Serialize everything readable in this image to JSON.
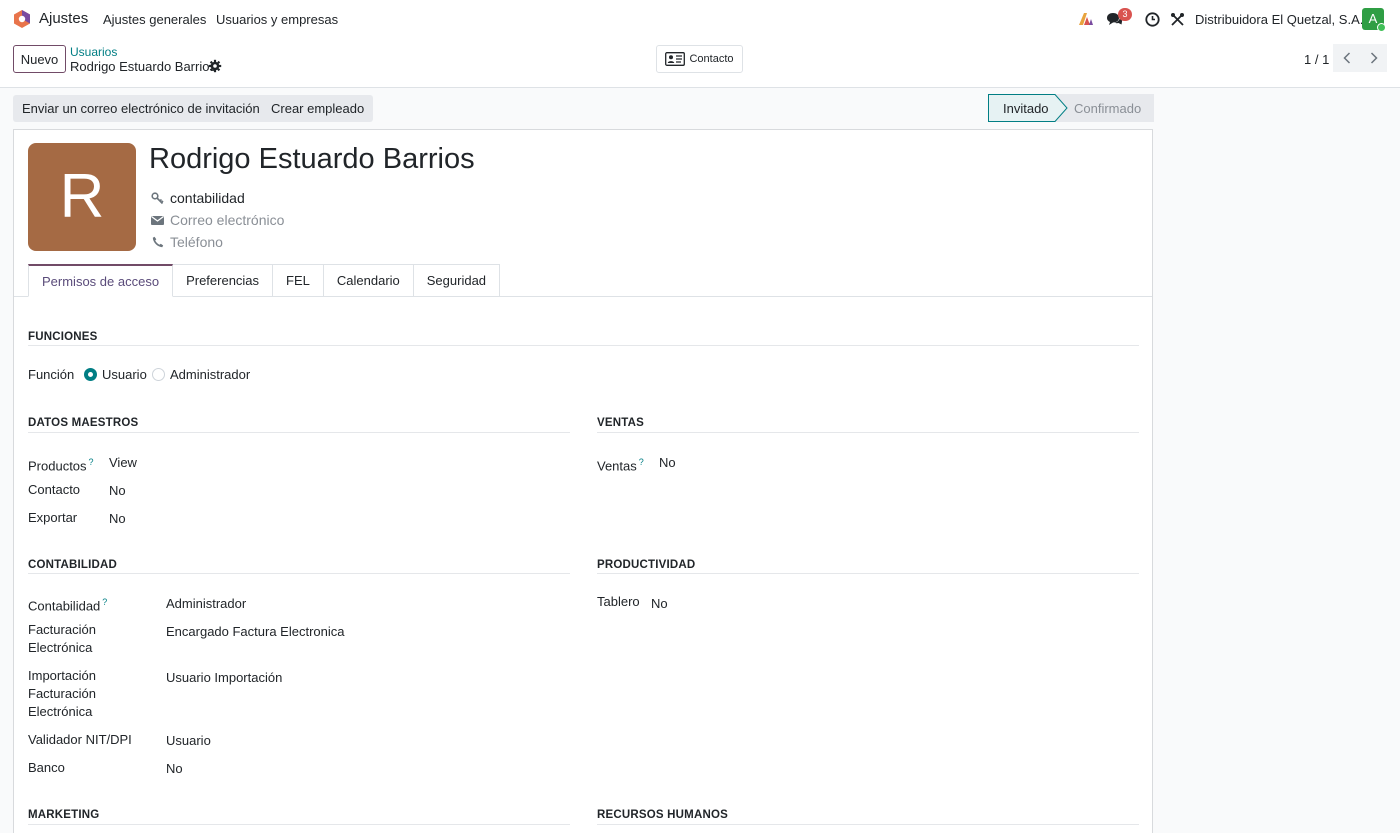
{
  "nav": {
    "app_name": "Ajustes",
    "menu": [
      "Ajustes generales",
      "Usuarios y empresas"
    ],
    "badge_count": "3",
    "company": "Distribuidora El Quetzal, S.A.",
    "user_initial": "A"
  },
  "control": {
    "new_label": "Nuevo",
    "breadcrumb_parent": "Usuarios",
    "breadcrumb_current": "Rodrigo Estuardo Barrios",
    "contact_label": "Contacto",
    "pager": "1 / 1"
  },
  "statusbar": {
    "invite_label": "Enviar un correo electrónico de invitación",
    "create_employee_label": "Crear empleado",
    "stages": [
      "Invitado",
      "Confirmado"
    ],
    "active_stage": "Invitado"
  },
  "user": {
    "initial": "R",
    "name": "Rodrigo Estuardo Barrios",
    "login": "contabilidad",
    "email_placeholder": "Correo electrónico",
    "phone_placeholder": "Teléfono"
  },
  "tabs": [
    "Permisos de acceso",
    "Preferencias",
    "FEL",
    "Calendario",
    "Seguridad"
  ],
  "functions": {
    "title": "FUNCIONES",
    "label": "Función",
    "options": [
      "Usuario",
      "Administrador"
    ],
    "selected": "Usuario"
  },
  "master_data": {
    "title": "DATOS MAESTROS",
    "rows": [
      {
        "label": "Productos",
        "value": "View",
        "help": "?"
      },
      {
        "label": "Contacto",
        "value": "No"
      },
      {
        "label": "Exportar",
        "value": "No"
      }
    ]
  },
  "sales": {
    "title": "VENTAS",
    "rows": [
      {
        "label": "Ventas",
        "value": "No",
        "help": "?"
      }
    ]
  },
  "accounting": {
    "title": "CONTABILIDAD",
    "rows": [
      {
        "label": "Contabilidad",
        "value": "Administrador",
        "help": "?"
      },
      {
        "label": "Facturación Electrónica",
        "value": "Encargado Factura Electronica"
      },
      {
        "label": "Importación Facturación Electrónica",
        "value": "Usuario Importación"
      },
      {
        "label": "Validador NIT/DPI",
        "value": "Usuario"
      },
      {
        "label": "Banco",
        "value": "No"
      }
    ]
  },
  "productivity": {
    "title": "PRODUCTIVIDAD",
    "rows": [
      {
        "label": "Tablero",
        "value": "No"
      }
    ]
  },
  "marketing": {
    "title": "MARKETING"
  },
  "hr": {
    "title": "RECURSOS HUMANOS"
  },
  "colors": {
    "brand": "#714b67",
    "accent": "#017e84",
    "avatar": "#a56a44",
    "badge": "#d9534f"
  },
  "icons": [
    "odoo-logo-icon",
    "ai-icon",
    "chat-icon",
    "clock-icon",
    "tools-icon",
    "gear-icon",
    "contact-card-icon",
    "chevron-left-icon",
    "chevron-right-icon",
    "key-icon",
    "envelope-icon",
    "phone-icon"
  ]
}
